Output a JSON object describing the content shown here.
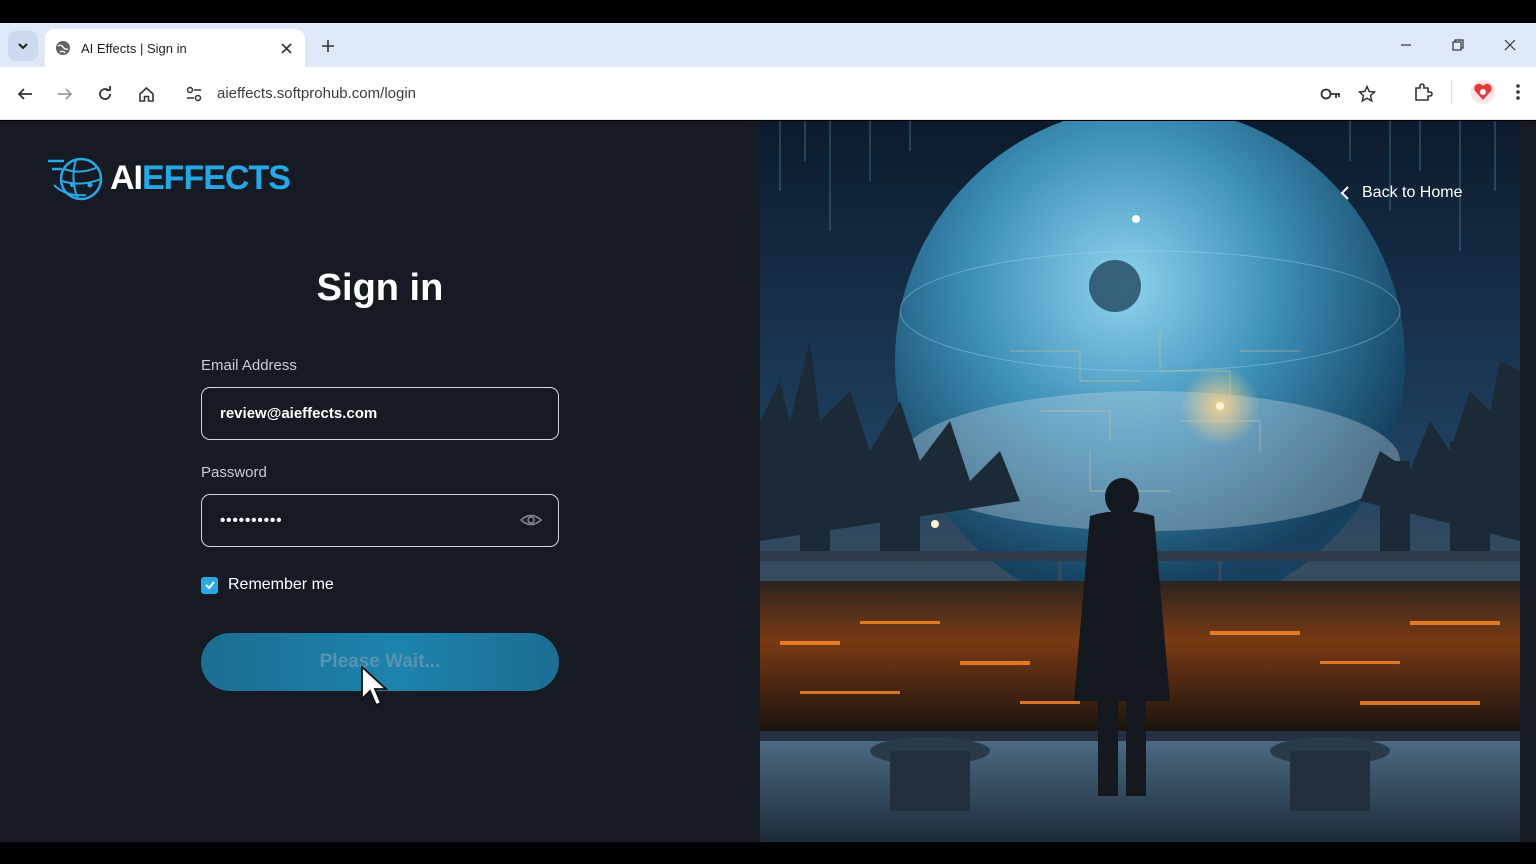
{
  "browser": {
    "tab_title": "AI Effects | Sign in",
    "url": "aieffects.softprohub.com/login"
  },
  "logo": {
    "text_ai": "AI",
    "text_effects": "EFFECTS"
  },
  "hero": {
    "back_home": "Back to Home"
  },
  "form": {
    "title": "Sign in",
    "email_label": "Email Address",
    "email_value": "review@aieffects.com",
    "password_label": "Password",
    "password_value": "••••••••••",
    "remember_label": "Remember me",
    "remember_checked": true,
    "submit_label": "Please Wait..."
  },
  "colors": {
    "accent": "#25a8e8",
    "page_bg": "#161a22",
    "button": "#1d83ad"
  },
  "icons": [
    "tab-search-icon",
    "globe-icon",
    "close-icon",
    "plus-icon",
    "minimize-icon",
    "restore-icon",
    "back-arrow-icon",
    "forward-arrow-icon",
    "reload-icon",
    "home-icon",
    "site-info-icon",
    "key-icon",
    "star-icon",
    "extensions-icon",
    "profile-icon",
    "menu-dots-icon",
    "eye-icon",
    "checkmark-icon",
    "chevron-left-icon",
    "cursor-arrow-icon"
  ]
}
